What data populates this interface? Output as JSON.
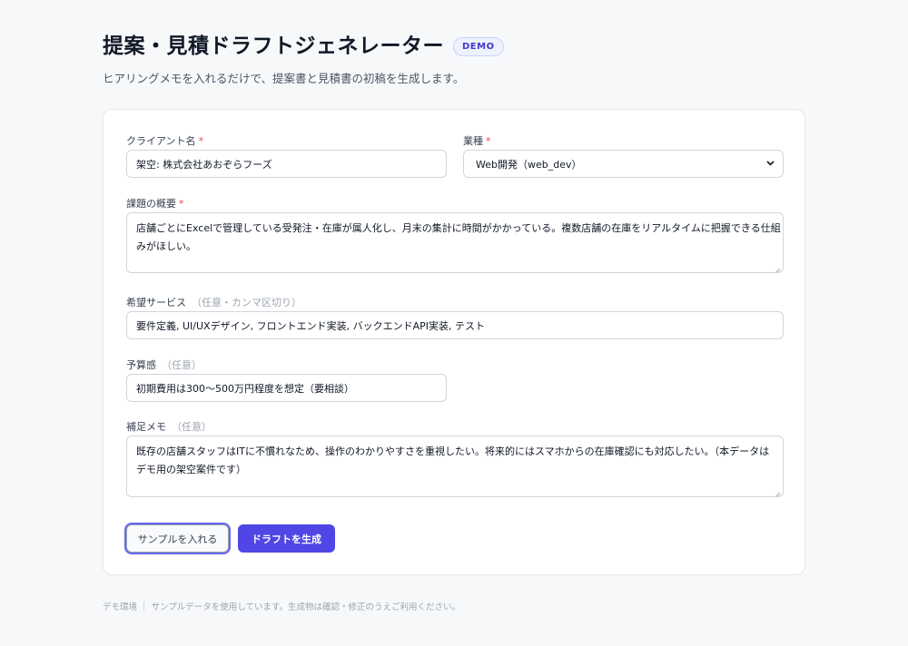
{
  "header": {
    "title": "提案・見積ドラフトジェネレーター",
    "badge": "DEMO",
    "subtitle": "ヒアリングメモを入れるだけで、提案書と見積書の初稿を生成します。"
  },
  "form": {
    "client": {
      "label": "クライアント名",
      "required_mark": "*",
      "value": "架空: 株式会社あおぞらフーズ"
    },
    "industry": {
      "label": "業種",
      "required_mark": "*",
      "selected": "Web開発（web_dev）"
    },
    "problem": {
      "label": "課題の概要",
      "required_mark": "*",
      "line1": "店舗ごとにExcelで管理している受発注・在庫が属人化し、月末の集計に時間がかかっている。複数店舗の在庫をリアルタイムに把握できる仕組",
      "line2": "みがほしい。"
    },
    "services": {
      "label": "希望サービス",
      "hint": "（任意・カンマ区切り）",
      "value": "要件定義, UI/UXデザイン, フロントエンド実装, バックエンドAPI実装, テスト"
    },
    "budget": {
      "label": "予算感",
      "hint": "（任意）",
      "value": "初期費用は300〜500万円程度を想定（要相談）"
    },
    "notes": {
      "label": "補足メモ",
      "hint": "（任意）",
      "line1": "既存の店舗スタッフはITに不慣れなため、操作のわかりやすさを重視したい。将来的にはスマホからの在庫確認にも対応したい。（本データは",
      "line2": "デモ用の架空案件です）"
    }
  },
  "buttons": {
    "sample": "サンプルを入れる",
    "generate": "ドラフトを生成"
  },
  "footer": {
    "text": "デモ環境 ｜ サンプルデータを使用しています。生成物は確認・修正のうえご利用ください。"
  },
  "colors": {
    "accent": "#4f46e5",
    "required": "#ef4444"
  },
  "icons": {
    "select": "chevron-down-icon",
    "resize": "resize-handle-icon"
  }
}
